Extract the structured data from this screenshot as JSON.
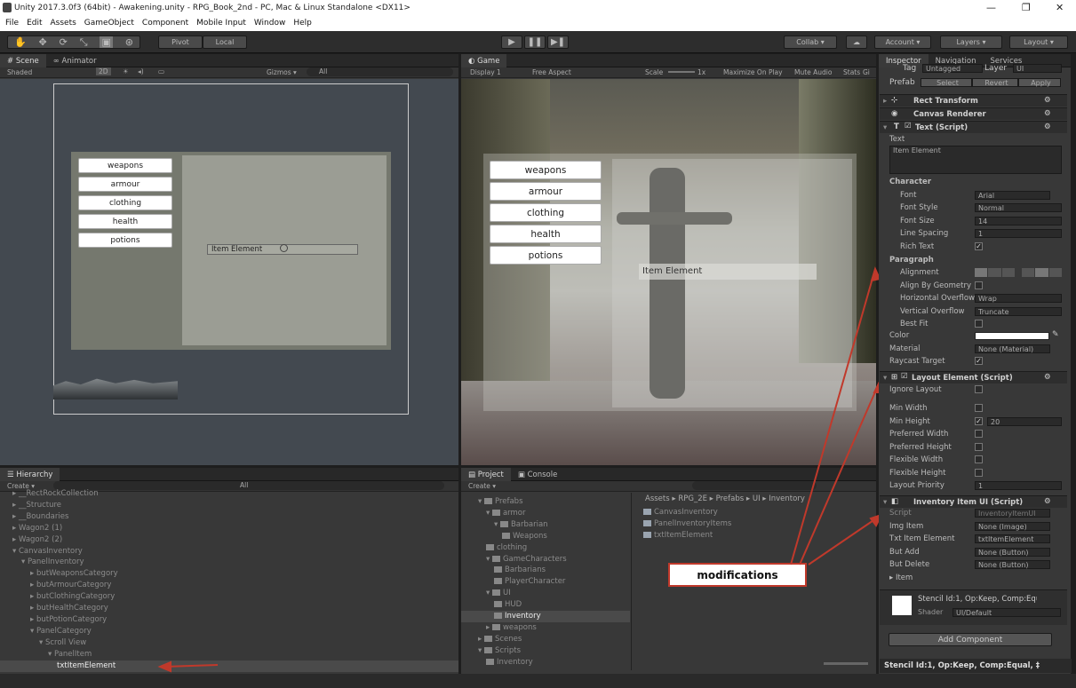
{
  "window": {
    "title": "Unity 2017.3.0f3 (64bit) - Awakening.unity - RPG_Book_2nd - PC, Mac & Linux Standalone <DX11>"
  },
  "menu": [
    "File",
    "Edit",
    "Assets",
    "GameObject",
    "Component",
    "Mobile Input",
    "Window",
    "Help"
  ],
  "toolbar": {
    "pivot": "Pivot",
    "local": "Local",
    "collab": "Collab",
    "account": "Account",
    "layers": "Layers",
    "layout": "Layout"
  },
  "scene": {
    "tab": "Scene",
    "tab2": "Animator",
    "shaded": "Shaded",
    "mode2d": "2D",
    "gizmos": "Gizmos",
    "search": "All",
    "buttons": [
      "weapons",
      "armour",
      "clothing",
      "health",
      "potions"
    ],
    "item": "Item Element"
  },
  "game": {
    "tab": "Game",
    "display": "Display 1",
    "aspect": "Free Aspect",
    "scale": "Scale",
    "scale_val": "1x",
    "maximize": "Maximize On Play",
    "mute": "Mute Audio",
    "stats": "Stats",
    "gizmos": "Gi",
    "buttons": [
      "weapons",
      "armour",
      "clothing",
      "health",
      "potions"
    ],
    "item": "Item Element"
  },
  "hierarchy": {
    "tab": "Hierarchy",
    "create": "Create",
    "search": "All",
    "items": [
      {
        "t": "__RectRockCollection",
        "d": 1,
        "a": "▸"
      },
      {
        "t": "__Structure",
        "d": 1,
        "a": "▸"
      },
      {
        "t": "__Boundaries",
        "d": 1,
        "a": "▸"
      },
      {
        "t": "Wagon2 (1)",
        "d": 1,
        "a": "▸"
      },
      {
        "t": "Wagon2 (2)",
        "d": 1,
        "a": "▸"
      },
      {
        "t": "CanvasInventory",
        "d": 1,
        "a": "▾"
      },
      {
        "t": "PanelInventory",
        "d": 2,
        "a": "▾"
      },
      {
        "t": "butWeaponsCategory",
        "d": 3,
        "a": "▸"
      },
      {
        "t": "butArmourCategory",
        "d": 3,
        "a": "▸"
      },
      {
        "t": "butClothingCategory",
        "d": 3,
        "a": "▸"
      },
      {
        "t": "butHealthCategory",
        "d": 3,
        "a": "▸"
      },
      {
        "t": "butPotionCategory",
        "d": 3,
        "a": "▸"
      },
      {
        "t": "PanelCategory",
        "d": 3,
        "a": "▾"
      },
      {
        "t": "Scroll View",
        "d": 4,
        "a": "▾"
      },
      {
        "t": "PanelItem",
        "d": 5,
        "a": "▾"
      },
      {
        "t": "txtItemElement",
        "d": 6,
        "a": "",
        "sel": true
      }
    ]
  },
  "project": {
    "tab": "Project",
    "tab2": "Console",
    "create": "Create",
    "tree": [
      {
        "t": "Prefabs",
        "d": 1,
        "a": "▾"
      },
      {
        "t": "armor",
        "d": 2,
        "a": "▾"
      },
      {
        "t": "Barbarian",
        "d": 3,
        "a": "▾"
      },
      {
        "t": "Weapons",
        "d": 4,
        "a": ""
      },
      {
        "t": "clothing",
        "d": 2,
        "a": ""
      },
      {
        "t": "GameCharacters",
        "d": 2,
        "a": "▾"
      },
      {
        "t": "Barbarians",
        "d": 3,
        "a": ""
      },
      {
        "t": "PlayerCharacter",
        "d": 3,
        "a": ""
      },
      {
        "t": "UI",
        "d": 2,
        "a": "▾"
      },
      {
        "t": "HUD",
        "d": 3,
        "a": ""
      },
      {
        "t": "Inventory",
        "d": 3,
        "a": "",
        "sel": true
      },
      {
        "t": "weapons",
        "d": 2,
        "a": "▸"
      },
      {
        "t": "Scenes",
        "d": 1,
        "a": "▸"
      },
      {
        "t": "Scripts",
        "d": 1,
        "a": "▾"
      },
      {
        "t": "Inventory",
        "d": 2,
        "a": ""
      }
    ],
    "breadcrumb": "Assets ▸ RPG_2E ▸ Prefabs ▸ UI ▸ Inventory",
    "assets": [
      "CanvasInventory",
      "PanelInventoryItems",
      "txtItemElement"
    ]
  },
  "annotation": "modifications",
  "inspector": {
    "tabs": [
      "Inspector",
      "Navigation",
      "Services"
    ],
    "tag_label": "Tag",
    "tag": "Untagged",
    "layer_label": "Layer",
    "layer": "UI",
    "prefab": "Prefab",
    "select": "Select",
    "revert": "Revert",
    "apply": "Apply",
    "rect": "Rect Transform",
    "canvas_renderer": "Canvas Renderer",
    "text_script": "Text (Script)",
    "text_label": "Text",
    "text_value": "Item Element",
    "character": "Character",
    "font_label": "Font",
    "font": "Arial",
    "style_label": "Font Style",
    "style": "Normal",
    "size_label": "Font Size",
    "size": "14",
    "spacing_label": "Line Spacing",
    "spacing": "1",
    "rich_label": "Rich Text",
    "paragraph": "Paragraph",
    "align_label": "Alignment",
    "geom_label": "Align By Geometry",
    "hover_label": "Horizontal Overflow",
    "hover": "Wrap",
    "vover_label": "Vertical Overflow",
    "vover": "Truncate",
    "bestfit_label": "Best Fit",
    "color_label": "Color",
    "material_label": "Material",
    "material": "None (Material)",
    "raycast_label": "Raycast Target",
    "layout_element": "Layout Element (Script)",
    "ignore": "Ignore Layout",
    "min_w": "Min Width",
    "min_h": "Min Height",
    "min_h_val": "20",
    "pref_w": "Preferred Width",
    "pref_h": "Preferred Height",
    "flex_w": "Flexible Width",
    "flex_h": "Flexible Height",
    "priority": "Layout Priority",
    "priority_val": "1",
    "inv_script": "Inventory Item UI (Script)",
    "script_label": "Script",
    "script_val": "InventoryItemUI",
    "img_label": "Img Item",
    "img_val": "None (Image)",
    "txt_label": "Txt Item Element",
    "txt_val": "txtItemElement",
    "add_label": "But Add",
    "add_val": "None (Button)",
    "del_label": "But Delete",
    "del_val": "None (Button)",
    "item_label": "Item",
    "stencil": "Stencil Id:1, Op:Keep, Comp:Equal,",
    "shader_label": "Shader",
    "shader": "UI/Default",
    "add_component": "Add Component",
    "status": "Stencil Id:1, Op:Keep, Comp:Equal, ‡"
  },
  "colors": {
    "accent": "#3e7dd6",
    "annotation_border": "#c0392b",
    "arrow": "#c0392b"
  }
}
